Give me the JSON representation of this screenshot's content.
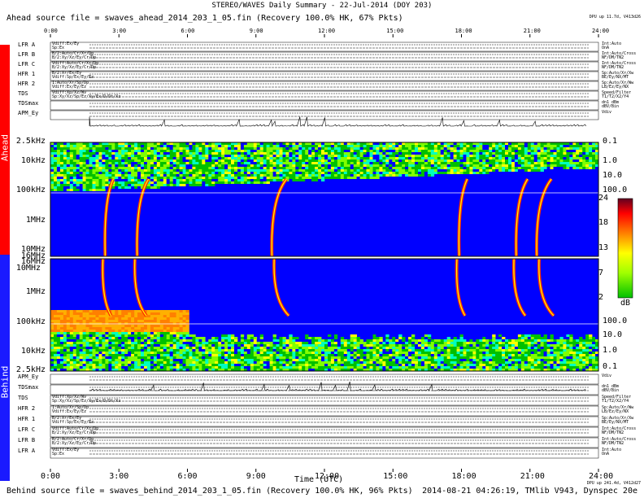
{
  "header": {
    "title": "STEREO/WAVES Daily Summary - 22-Jul-2014 (DOY 203)",
    "ahead_source": "Ahead source file = swaves_ahead_2014_203_1_05.fin (Recovery 100.0% HK, 67% Pkts)",
    "dpu_ahead": "DPU up 11.7d, V413d26"
  },
  "footer": {
    "behind_source": "Behind source file = swaves_behind_2014_203_1_05.fin (Recovery 100.0% HK, 96% Pkts)",
    "stamp": "2014-08-21 04:26:19, TMlib V943, Dynspec 20e",
    "dpu_behind": "DPU up 241.4d, V412d27"
  },
  "sidebars": {
    "ahead": "Ahead",
    "behind": "Behind"
  },
  "colors": {
    "ahead_bar": "#ff0000",
    "behind_bar": "#1a1aff",
    "background": "#0000ff"
  },
  "time_axis": {
    "ticks": [
      "0:00",
      "3:00",
      "6:00",
      "9:00",
      "12:00",
      "15:00",
      "18:00",
      "21:00",
      "24:00"
    ],
    "xlabel": "Time (UTC)"
  },
  "ahead_rows": [
    {
      "label": "LFR A",
      "left1": "Vdiff:Ex/Ey",
      "left2": "Sp:Ex",
      "right1": "Int:Auto",
      "right2": "OnA"
    },
    {
      "label": "LFR B",
      "left1": "B/2:Auto/Cr/Xr/Dp",
      "left2": "B/2:Xy/Xz/Ey/Cr/Dp",
      "right1": "Int:Auto/Cross",
      "right2": "NF/DM/TN2"
    },
    {
      "label": "LFR C",
      "left1": "Vdiff:Auto/Cr/Xr/Dp",
      "left2": "B/2:Xy/Xz/Ey/Cr/Dp",
      "right1": "Int:Auto/Cross",
      "right2": "NF/DM/TN2"
    },
    {
      "label": "HFR 1",
      "left1": "B/2:Xr/Ex/Ey",
      "left2": "Vdiff:Sp/Ex/Ey/Ez",
      "right1": "Sp:Auto/Xr/Xw",
      "right2": "BE/Ey/NX/MT"
    },
    {
      "label": "HFR 2",
      "left1": "1:Auto/Xr/Sp/Dp",
      "left2": "Vdiff:Ex/Ey/Ez",
      "right1": "Sp:Auto/Xr/Ww",
      "right2": "LB/Ez/Ey/NX"
    },
    {
      "label": "TDS",
      "left1": "Vdiff:Xp/Xz/Wv",
      "left2": "Sp:Xy/Xz/Sp/Ez/Xy/Ex/D/Dt/Xz",
      "right1": "Speed/Filter",
      "right2": "T1/T2/X2/Y4"
    },
    {
      "label": "TDSmax",
      "left1": "",
      "left2": "",
      "right1": "dn1 dBm",
      "right2": "dBV/Bin"
    },
    {
      "label": "APM_Ey",
      "left1": "",
      "left2": "",
      "right1": "Vdiv",
      "right2": ""
    }
  ],
  "behind_rows": [
    {
      "label": "APM_Ey",
      "left1": "",
      "left2": "",
      "right1": "Vdiv",
      "right2": ""
    },
    {
      "label": "TDSmax",
      "left1": "",
      "left2": "",
      "right1": "dn1 dBm",
      "right2": "dBV/Bin"
    },
    {
      "label": "TDS",
      "left1": "Vdiff:Xp/Xz/Wv",
      "left2": "Sp:Xy/Xz/Sp/Ez/Xy/Ex/D/Dt/Xz",
      "right1": "Speed/Filter",
      "right2": "T1/T2/X2/Y4"
    },
    {
      "label": "HFR 2",
      "left1": "1:Auto/Xr/Sp/Dp",
      "left2": "Vdiff:Ex/Ey/Ez",
      "right1": "Sp:Auto/Xr/Ww",
      "right2": "LB/Ez/Ey/NX"
    },
    {
      "label": "HFR 1",
      "left1": "B/2:Xr/Ex/Ey",
      "left2": "Vdiff:Sp/Ex/Ey/Ez",
      "right1": "Sp:Auto/Xr/Xw",
      "right2": "BE/Ey/NX/MT"
    },
    {
      "label": "LFR C",
      "left1": "Vdiff:Auto/Cr/Xr/Dp",
      "left2": "B/2:Xy/Xz/Ey/Cr/Dp",
      "right1": "Int:Auto/Cross",
      "right2": "NF/DM/TN2"
    },
    {
      "label": "LFR B",
      "left1": "B/2:Auto/Cr/Xr/Dp",
      "left2": "B/2:Xy/Xz/Ey/Cr/Dp",
      "right1": "Int:Auto/Cross",
      "right2": "NF/DM/TN2"
    },
    {
      "label": "LFR A",
      "left1": "Vdiff:Ex/Ey",
      "left2": "Sp:Ex",
      "right1": "Int:Auto",
      "right2": "OnA"
    }
  ],
  "chart_data": [
    {
      "type": "heatmap",
      "title": "STEREO/WAVES Daily Summary - 22-Jul-2014 (DOY 203)",
      "panel": "Ahead",
      "xlabel": "Time (UTC)",
      "xlim": [
        0,
        24
      ],
      "freq_tick_labels": [
        "2.5kHz",
        "10kHz",
        "100kHz",
        "1MHz",
        "10MHz",
        "16MHz"
      ],
      "right_tick_labels": [
        "0.1",
        "1.0",
        "10.0",
        "100.0"
      ],
      "bursts_hours": [
        2.4,
        3.8,
        9.7,
        17.9,
        20.4,
        21.3
      ],
      "background_enhanced_until_hours": 24
    },
    {
      "type": "heatmap",
      "panel": "Behind",
      "xlabel": "Time (UTC)",
      "xlim": [
        0,
        24
      ],
      "freq_tick_labels": [
        "16MHz",
        "10MHz",
        "1MHz",
        "100kHz",
        "10kHz",
        "2.5kHz"
      ],
      "right_tick_labels": [
        "100.0",
        "10.0",
        "1.0",
        "0.1"
      ],
      "bursts_hours": [
        2.3,
        3.7,
        9.8,
        17.8,
        20.3,
        21.4
      ],
      "low_freq_enhanced_until_hours": 6
    }
  ],
  "colorbar": {
    "ticks": [
      "24",
      "18",
      "13",
      "7",
      "2"
    ],
    "unit": "dB",
    "min": 2,
    "max": 24
  }
}
